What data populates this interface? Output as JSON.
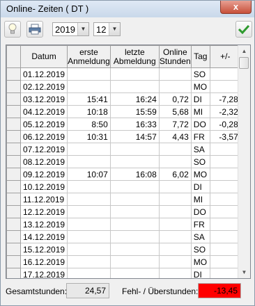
{
  "window": {
    "title": "Online- Zeiten ( DT )",
    "close_glyph": "x"
  },
  "toolbar": {
    "bulb_icon": "lightbulb-icon",
    "print_icon": "printer-icon",
    "ok_icon": "checkmark-icon",
    "year": "2019",
    "month": "12"
  },
  "grid": {
    "headers": {
      "datum": "Datum",
      "erste_1": "erste",
      "erste_2": "Anmeldung",
      "letzte_1": "letzte",
      "letzte_2": "Abmeldung",
      "online_1": "Online",
      "online_2": "Stunden",
      "tag": "Tag",
      "diff": "+/-"
    },
    "rows": [
      {
        "datum": "01.12.2019",
        "erste": "",
        "letzte": "",
        "stunden": "",
        "tag": "SO",
        "diff": ""
      },
      {
        "datum": "02.12.2019",
        "erste": "",
        "letzte": "",
        "stunden": "",
        "tag": "MO",
        "diff": ""
      },
      {
        "datum": "03.12.2019",
        "erste": "15:41",
        "letzte": "16:24",
        "stunden": "0,72",
        "tag": "DI",
        "diff": "-7,28"
      },
      {
        "datum": "04.12.2019",
        "erste": "10:18",
        "letzte": "15:59",
        "stunden": "5,68",
        "tag": "MI",
        "diff": "-2,32"
      },
      {
        "datum": "05.12.2019",
        "erste": "8:50",
        "letzte": "16:33",
        "stunden": "7,72",
        "tag": "DO",
        "diff": "-0,28"
      },
      {
        "datum": "06.12.2019",
        "erste": "10:31",
        "letzte": "14:57",
        "stunden": "4,43",
        "tag": "FR",
        "diff": "-3,57"
      },
      {
        "datum": "07.12.2019",
        "erste": "",
        "letzte": "",
        "stunden": "",
        "tag": "SA",
        "diff": ""
      },
      {
        "datum": "08.12.2019",
        "erste": "",
        "letzte": "",
        "stunden": "",
        "tag": "SO",
        "diff": ""
      },
      {
        "datum": "09.12.2019",
        "erste": "10:07",
        "letzte": "16:08",
        "stunden": "6,02",
        "tag": "MO",
        "diff": ""
      },
      {
        "datum": "10.12.2019",
        "erste": "",
        "letzte": "",
        "stunden": "",
        "tag": "DI",
        "diff": ""
      },
      {
        "datum": "11.12.2019",
        "erste": "",
        "letzte": "",
        "stunden": "",
        "tag": "MI",
        "diff": ""
      },
      {
        "datum": "12.12.2019",
        "erste": "",
        "letzte": "",
        "stunden": "",
        "tag": "DO",
        "diff": ""
      },
      {
        "datum": "13.12.2019",
        "erste": "",
        "letzte": "",
        "stunden": "",
        "tag": "FR",
        "diff": ""
      },
      {
        "datum": "14.12.2019",
        "erste": "",
        "letzte": "",
        "stunden": "",
        "tag": "SA",
        "diff": ""
      },
      {
        "datum": "15.12.2019",
        "erste": "",
        "letzte": "",
        "stunden": "",
        "tag": "SO",
        "diff": ""
      },
      {
        "datum": "16.12.2019",
        "erste": "",
        "letzte": "",
        "stunden": "",
        "tag": "MO",
        "diff": ""
      },
      {
        "datum": "17.12.2019",
        "erste": "",
        "letzte": "",
        "stunden": "",
        "tag": "DI",
        "diff": ""
      }
    ]
  },
  "footer": {
    "gesamt_label": "Gesamtstunden:",
    "gesamt_value": "24,57",
    "fehl_label": "Fehl- / Überstunden:",
    "fehl_value": "-13,45",
    "fehl_color": "#ff0000"
  }
}
